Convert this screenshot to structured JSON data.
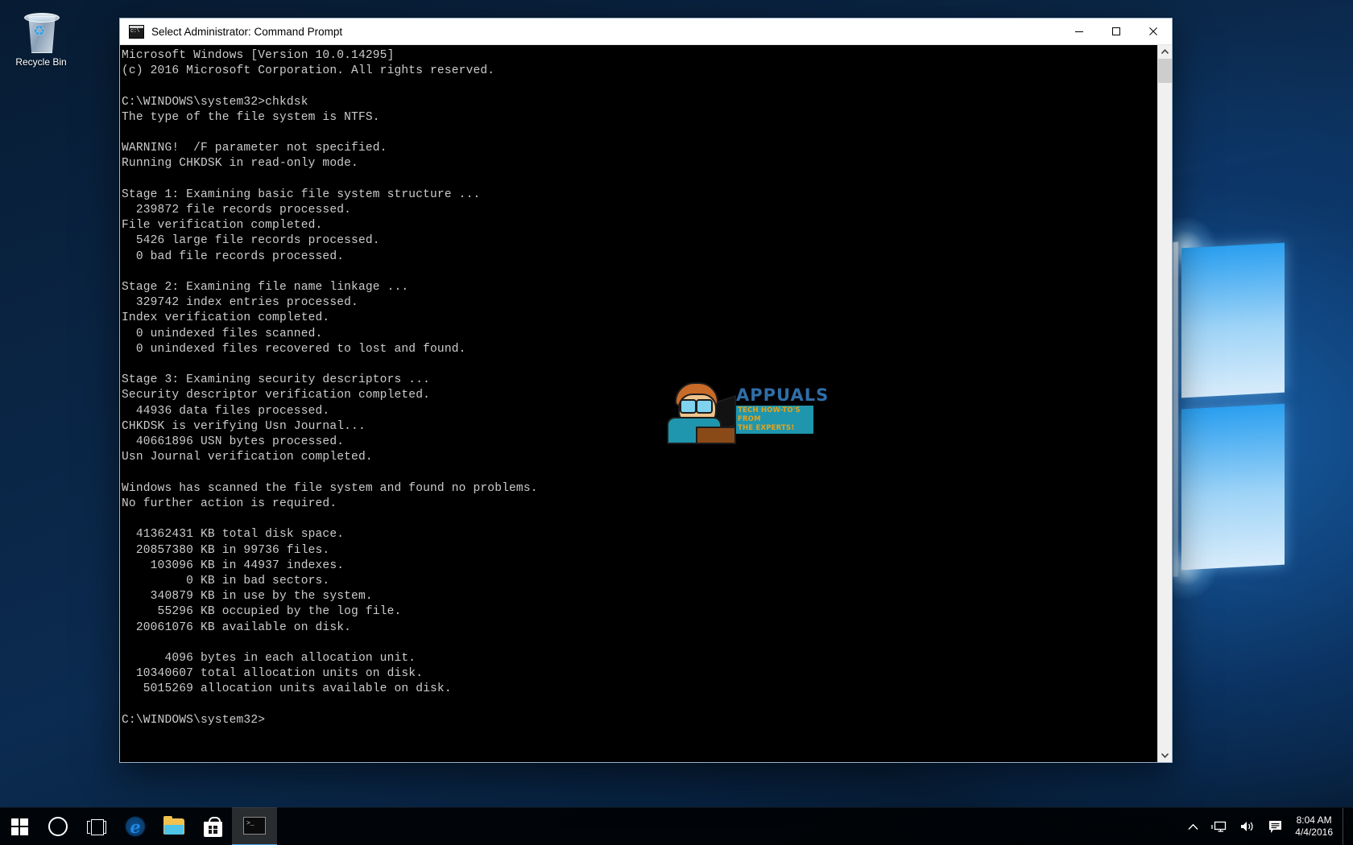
{
  "desktop": {
    "recycle_bin": {
      "label": "Recycle Bin",
      "icon": "recycle-bin-icon"
    }
  },
  "window": {
    "title": "Select Administrator: Command Prompt",
    "icon": "command-prompt-icon",
    "controls": {
      "minimize": "minimize-button",
      "maximize": "maximize-button",
      "close": "close-button"
    },
    "scrollbar": {
      "up_arrow": "scroll-up-icon",
      "down_arrow": "scroll-down-icon"
    }
  },
  "terminal": {
    "text": "Microsoft Windows [Version 10.0.14295]\n(c) 2016 Microsoft Corporation. All rights reserved.\n\nC:\\WINDOWS\\system32>chkdsk\nThe type of the file system is NTFS.\n\nWARNING!  /F parameter not specified.\nRunning CHKDSK in read-only mode.\n\nStage 1: Examining basic file system structure ...\n  239872 file records processed.\nFile verification completed.\n  5426 large file records processed.\n  0 bad file records processed.\n\nStage 2: Examining file name linkage ...\n  329742 index entries processed.\nIndex verification completed.\n  0 unindexed files scanned.\n  0 unindexed files recovered to lost and found.\n\nStage 3: Examining security descriptors ...\nSecurity descriptor verification completed.\n  44936 data files processed.\nCHKDSK is verifying Usn Journal...\n  40661896 USN bytes processed.\nUsn Journal verification completed.\n\nWindows has scanned the file system and found no problems.\nNo further action is required.\n\n  41362431 KB total disk space.\n  20857380 KB in 99736 files.\n    103096 KB in 44937 indexes.\n         0 KB in bad sectors.\n    340879 KB in use by the system.\n     55296 KB occupied by the log file.\n  20061076 KB available on disk.\n\n      4096 bytes in each allocation unit.\n  10340607 total allocation units on disk.\n   5015269 allocation units available on disk.\n\nC:\\WINDOWS\\system32>",
    "lines": [
      "Microsoft Windows [Version 10.0.14295]",
      "(c) 2016 Microsoft Corporation. All rights reserved.",
      "",
      "C:\\WINDOWS\\system32>chkdsk",
      "The type of the file system is NTFS.",
      "",
      "WARNING!  /F parameter not specified.",
      "Running CHKDSK in read-only mode.",
      "",
      "Stage 1: Examining basic file system structure ...",
      "  239872 file records processed.",
      "File verification completed.",
      "  5426 large file records processed.",
      "  0 bad file records processed.",
      "",
      "Stage 2: Examining file name linkage ...",
      "  329742 index entries processed.",
      "Index verification completed.",
      "  0 unindexed files scanned.",
      "  0 unindexed files recovered to lost and found.",
      "",
      "Stage 3: Examining security descriptors ...",
      "Security descriptor verification completed.",
      "  44936 data files processed.",
      "CHKDSK is verifying Usn Journal...",
      "  40661896 USN bytes processed.",
      "Usn Journal verification completed.",
      "",
      "Windows has scanned the file system and found no problems.",
      "No further action is required.",
      "",
      "  41362431 KB total disk space.",
      "  20857380 KB in 99736 files.",
      "    103096 KB in 44937 indexes.",
      "         0 KB in bad sectors.",
      "    340879 KB in use by the system.",
      "     55296 KB occupied by the log file.",
      "  20061076 KB available on disk.",
      "",
      "      4096 bytes in each allocation unit.",
      "  10340607 total allocation units on disk.",
      "   5015269 allocation units available on disk.",
      "",
      "C:\\WINDOWS\\system32>"
    ],
    "colors": {
      "background": "#000000",
      "foreground": "#cccccc"
    }
  },
  "watermark": {
    "brand": "APPUALS",
    "tagline_line1": "TECH HOW-TO'S FROM",
    "tagline_line2": "THE EXPERTS!",
    "brand_color": "#2f6ea8",
    "tagline_color": "#e8a317"
  },
  "taskbar": {
    "items": [
      {
        "name": "start-button",
        "label": "Start",
        "icon": "windows-logo-icon"
      },
      {
        "name": "cortana-search-button",
        "label": "Cortana",
        "icon": "cortana-circle-icon"
      },
      {
        "name": "task-view-button",
        "label": "Task View",
        "icon": "task-view-icon"
      },
      {
        "name": "edge-button",
        "label": "Microsoft Edge",
        "icon": "edge-icon"
      },
      {
        "name": "file-explorer-button",
        "label": "File Explorer",
        "icon": "folder-icon"
      },
      {
        "name": "store-button",
        "label": "Microsoft Store",
        "icon": "store-bag-icon"
      },
      {
        "name": "command-prompt-taskbar-button",
        "label": "Command Prompt",
        "icon": "command-prompt-icon"
      }
    ],
    "tray": {
      "show_hidden_icon": "chevron-up-icon",
      "network_icon": "network-monitor-icon",
      "volume_icon": "speaker-icon",
      "action_center_icon": "action-center-icon",
      "time": "8:04 AM",
      "date": "4/4/2016"
    }
  }
}
